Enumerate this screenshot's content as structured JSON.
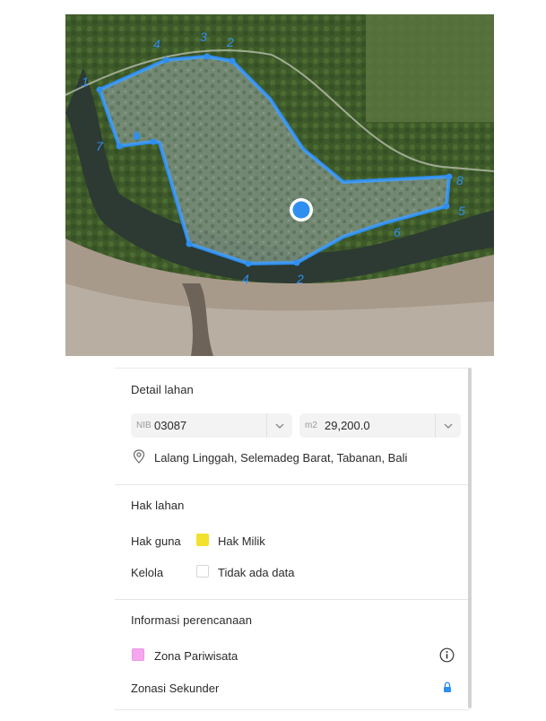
{
  "map": {
    "accent": "#2f8ff0",
    "marker_color": "#2f8ff0",
    "boundary_labels": [
      "4",
      "3",
      "2",
      "1",
      "7",
      "5",
      "8",
      "6",
      "5",
      "4",
      "2"
    ]
  },
  "detail": {
    "title": "Detail lahan",
    "nib_prefix": "NIB",
    "nib_value": "03087",
    "area_prefix": "m2",
    "area_value": "29,200.0",
    "location_icon": "location-pin-icon",
    "address": "Lalang Linggah, Selemadeg Barat, Tabanan, Bali"
  },
  "rights": {
    "title": "Hak lahan",
    "use_label": "Hak guna",
    "use_value": "Hak Milik",
    "use_color": "#f2e22e",
    "manage_label": "Kelola",
    "manage_value": "Tidak ada data",
    "manage_color": "#ffffff"
  },
  "planning": {
    "title": "Informasi perencanaan",
    "zone_label": "Zona Pariwisata",
    "zone_color": "#f6a6ee",
    "info_icon": "info-icon",
    "secondary_label": "Zonasi Sekunder",
    "lock_icon": "lock-icon"
  }
}
